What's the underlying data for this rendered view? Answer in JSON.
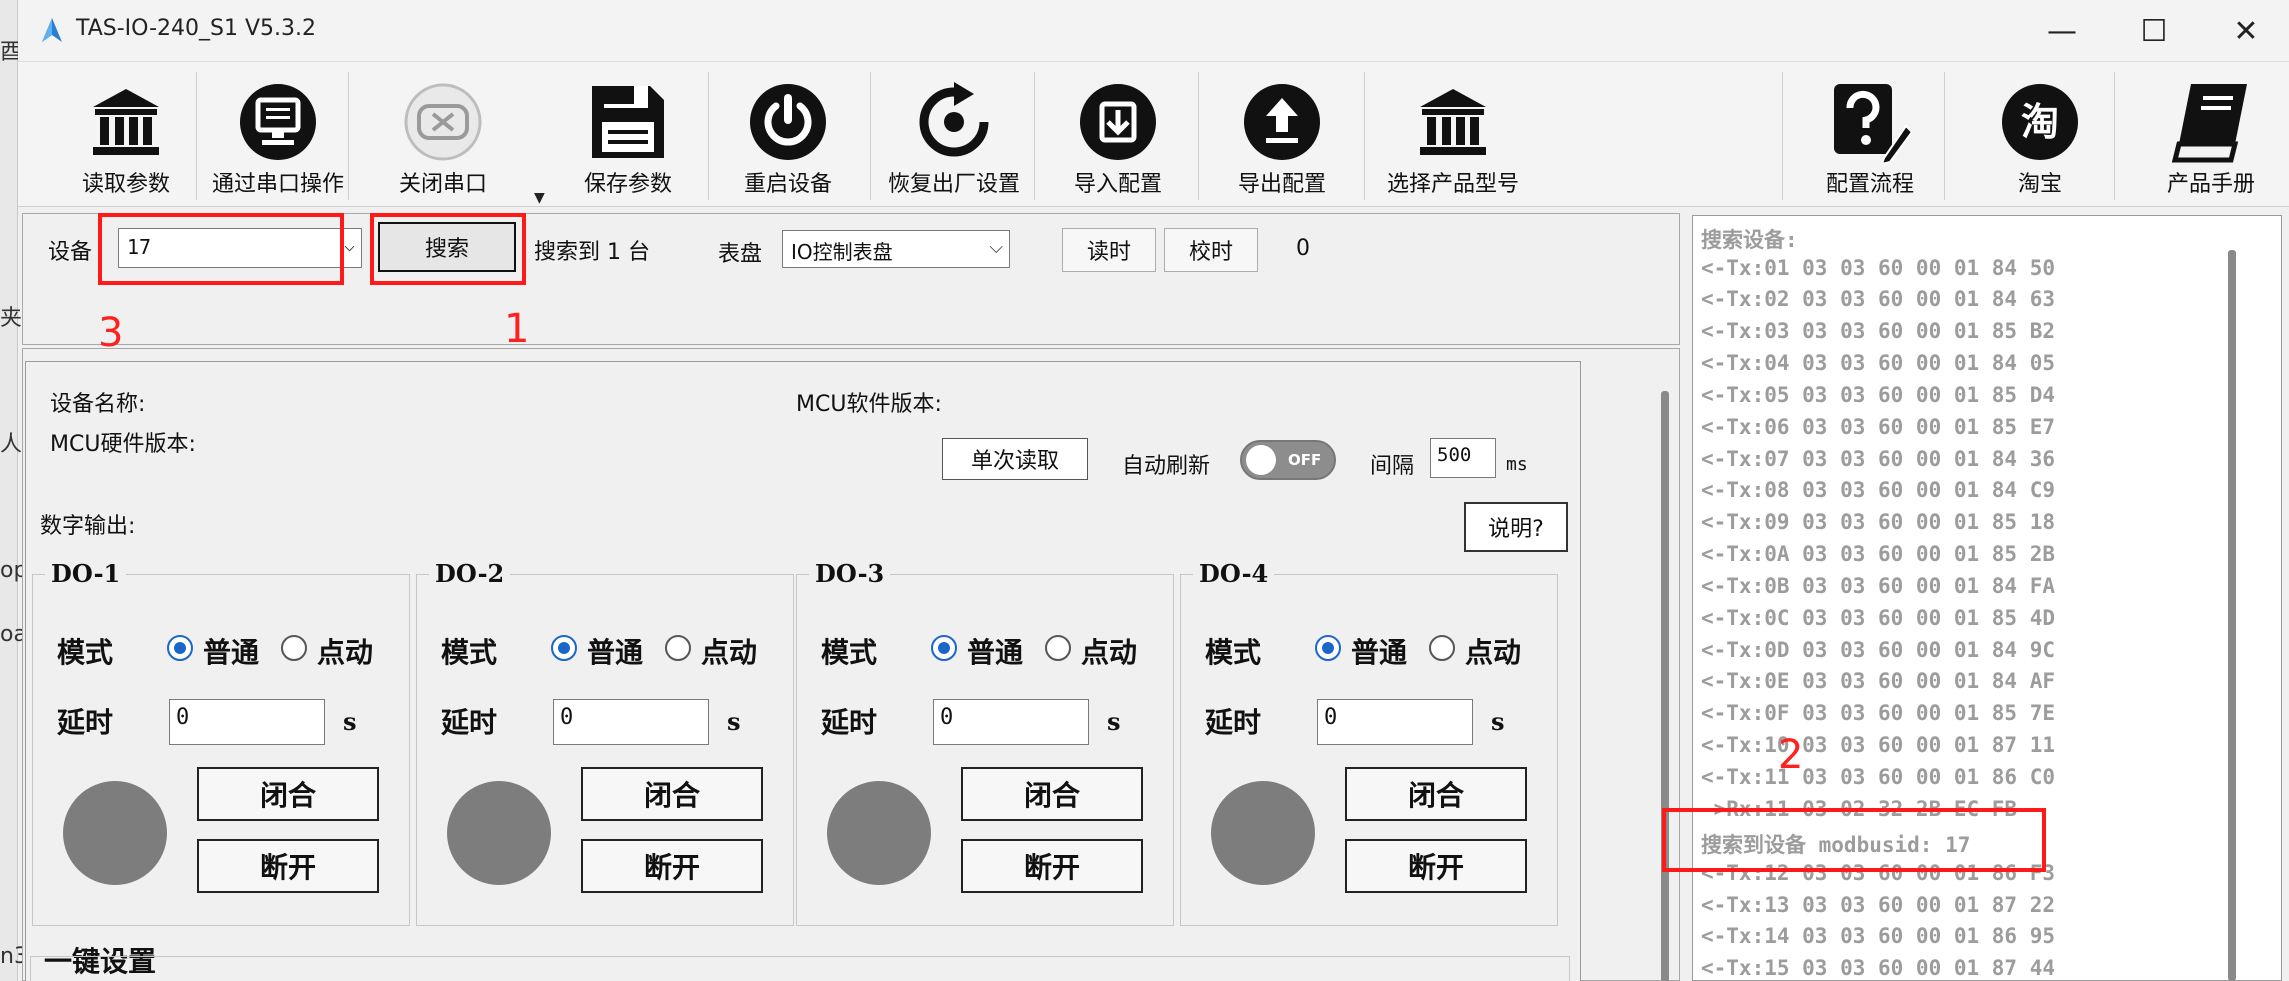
{
  "window": {
    "title": "TAS-IO-240_S1 V5.3.2",
    "controls": {
      "minimize": "—",
      "maximize": "☐",
      "close": "✕"
    }
  },
  "left_strip": [
    "酉",
    "夹",
    "人",
    "op",
    "oa",
    "n3"
  ],
  "toolbar": {
    "items": [
      {
        "label": "读取参数",
        "icon": "bank-icon"
      },
      {
        "label": "通过串口操作",
        "icon": "monitor-icon"
      },
      {
        "label": "关闭串口",
        "icon": "serial-close-icon"
      },
      {
        "label": "保存参数",
        "icon": "floppy-icon"
      },
      {
        "label": "重启设备",
        "icon": "power-icon"
      },
      {
        "label": "恢复出厂设置",
        "icon": "restore-icon"
      },
      {
        "label": "导入配置",
        "icon": "import-icon"
      },
      {
        "label": "导出配置",
        "icon": "export-icon"
      },
      {
        "label": "选择产品型号",
        "icon": "bank-icon"
      },
      {
        "label": "配置流程",
        "icon": "help-icon"
      },
      {
        "label": "淘宝",
        "icon": "taobao-icon",
        "glyph": "淘"
      },
      {
        "label": "产品手册",
        "icon": "book-icon"
      }
    ]
  },
  "device_bar": {
    "device_label": "设备",
    "device_value": "17",
    "search_button": "搜索",
    "search_result": "搜索到 1 台",
    "meter_label": "表盘",
    "meter_value": "IO控制表盘",
    "read_time_button": "读时",
    "calibrate_button": "校时",
    "time_value": "0"
  },
  "annotations": {
    "a1": "1",
    "a2": "2",
    "a3": "3"
  },
  "info": {
    "device_name_label": "设备名称:",
    "mcu_hw_label": "MCU硬件版本:",
    "mcu_sw_label": "MCU软件版本:",
    "single_read_button": "单次读取",
    "auto_refresh_label": "自动刷新",
    "toggle_text": "OFF",
    "interval_label": "间隔",
    "interval_value": "500",
    "interval_unit": "ms"
  },
  "digital_output": {
    "section_label": "数字输出:",
    "help_button": "说明?",
    "channels": [
      {
        "title": "DO-1",
        "mode_label": "模式",
        "opt_normal": "普通",
        "opt_jog": "点动",
        "delay_label": "延时",
        "delay_value": "0",
        "unit": "s",
        "close_btn": "闭合",
        "open_btn": "断开"
      },
      {
        "title": "DO-2",
        "mode_label": "模式",
        "opt_normal": "普通",
        "opt_jog": "点动",
        "delay_label": "延时",
        "delay_value": "0",
        "unit": "s",
        "close_btn": "闭合",
        "open_btn": "断开"
      },
      {
        "title": "DO-3",
        "mode_label": "模式",
        "opt_normal": "普通",
        "opt_jog": "点动",
        "delay_label": "延时",
        "delay_value": "0",
        "unit": "s",
        "close_btn": "闭合",
        "open_btn": "断开"
      },
      {
        "title": "DO-4",
        "mode_label": "模式",
        "opt_normal": "普通",
        "opt_jog": "点动",
        "delay_label": "延时",
        "delay_value": "0",
        "unit": "s",
        "close_btn": "闭合",
        "open_btn": "断开"
      }
    ],
    "one_key_label": "一键设置"
  },
  "log": {
    "lines": [
      "搜索设备:",
      "<-Tx:01 03 03 60 00 01 84 50",
      "<-Tx:02 03 03 60 00 01 84 63",
      "<-Tx:03 03 03 60 00 01 85 B2",
      "<-Tx:04 03 03 60 00 01 84 05",
      "<-Tx:05 03 03 60 00 01 85 D4",
      "<-Tx:06 03 03 60 00 01 85 E7",
      "<-Tx:07 03 03 60 00 01 84 36",
      "<-Tx:08 03 03 60 00 01 84 C9",
      "<-Tx:09 03 03 60 00 01 85 18",
      "<-Tx:0A 03 03 60 00 01 85 2B",
      "<-Tx:0B 03 03 60 00 01 84 FA",
      "<-Tx:0C 03 03 60 00 01 85 4D",
      "<-Tx:0D 03 03 60 00 01 84 9C",
      "<-Tx:0E 03 03 60 00 01 84 AF",
      "<-Tx:0F 03 03 60 00 01 85 7E",
      "<-Tx:10 03 03 60 00 01 87 11",
      "<-Tx:11 03 03 60 00 01 86 C0",
      "->Rx:11 03 02 32 2B EC FB",
      "搜索到设备 modbusid: 17",
      "<-Tx:12 03 03 60 00 01 86 F3",
      "<-Tx:13 03 03 60 00 01 87 22",
      "<-Tx:14 03 03 60 00 01 86 95",
      "<-Tx:15 03 03 60 00 01 87 44"
    ]
  }
}
